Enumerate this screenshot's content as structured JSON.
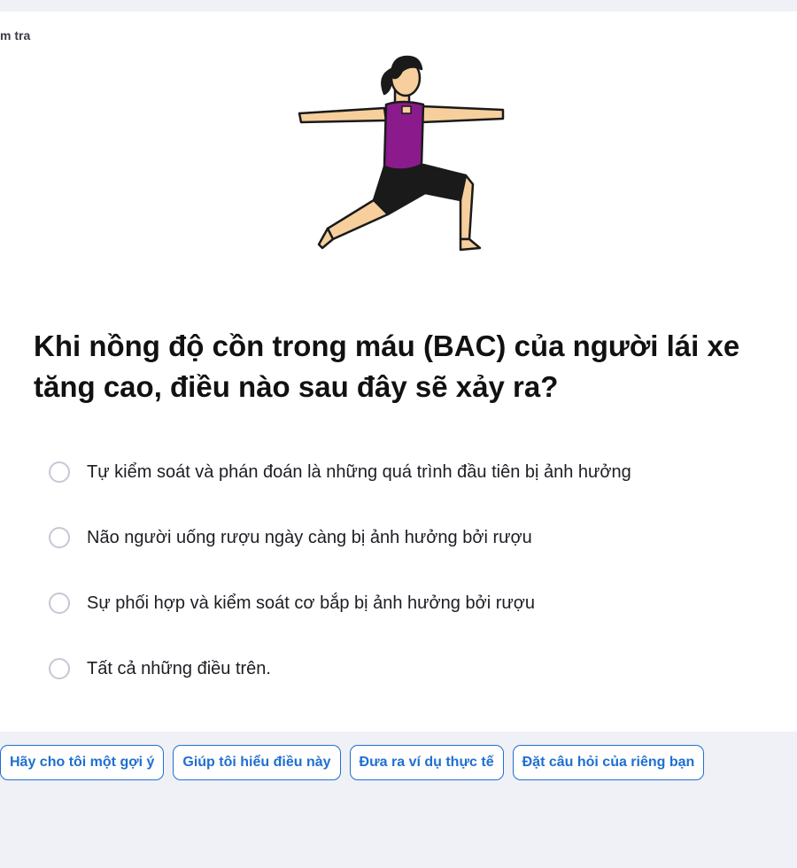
{
  "breadcrumb": {
    "label": "m tra"
  },
  "illustration": {
    "icon": "yoga-warrior-pose-illustration"
  },
  "question": {
    "text": "Khi nồng độ cồn trong máu (BAC) của người lái xe tăng cao, điều nào sau đây sẽ xảy ra?"
  },
  "options": [
    {
      "label": "Tự kiểm soát và phán đoán là những quá trình đầu tiên bị ảnh hưởng"
    },
    {
      "label": "Não người uống rượu ngày càng bị ảnh hưởng bởi rượu"
    },
    {
      "label": "Sự phối hợp và kiểm soát cơ bắp bị ảnh hưởng bởi rượu"
    },
    {
      "label": "Tất cả những điều trên."
    }
  ],
  "help_chips": [
    {
      "label": "Hãy cho tôi một gợi ý"
    },
    {
      "label": "Giúp tôi hiểu điều này"
    },
    {
      "label": "Đưa ra ví dụ thực tế"
    },
    {
      "label": "Đặt câu hỏi của riêng bạn"
    }
  ],
  "colors": {
    "accent": "#1f6fd1",
    "background": "#f0f1f6",
    "card": "#ffffff",
    "shirt": "#8b1a8c",
    "skin": "#f6cf9c"
  }
}
